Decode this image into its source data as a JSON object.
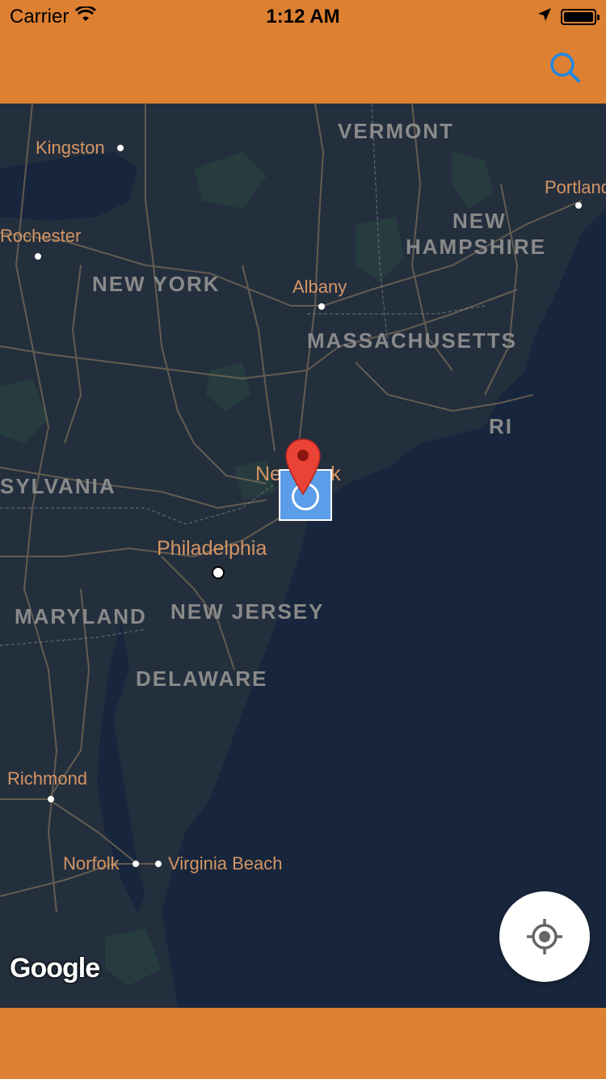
{
  "status_bar": {
    "carrier": "Carrier",
    "time": "1:12 AM",
    "battery_level": 1.0
  },
  "nav": {
    "search_icon": "search-icon"
  },
  "map": {
    "city_labels": {
      "kingston": "Kingston",
      "rochester": "Rochester",
      "portland": "Portland",
      "albany": "Albany",
      "new_york": "New York",
      "philadelphia": "Philadelphia",
      "richmond": "Richmond",
      "norfolk": "Norfolk",
      "virginia_beach": "Virginia Beach"
    },
    "state_labels": {
      "vermont": "VERMONT",
      "new_hampshire_1": "NEW",
      "new_hampshire_2": "HAMPSHIRE",
      "new_york": "NEW YORK",
      "massachusetts": "MASSACHUSETTS",
      "ri": "RI",
      "pennsylvania": "SYLVANIA",
      "maryland": "MARYLAND",
      "new_jersey": "NEW JERSEY",
      "delaware": "DELAWARE"
    },
    "attribution": "Google",
    "marker_icon": "map-pin-icon",
    "locate_icon": "crosshair-icon"
  },
  "colors": {
    "accent": "#dd8032",
    "map_land": "#242f3e",
    "map_water": "#17263c",
    "label_city": "#d59563",
    "label_state": "#8a8a8a",
    "search_icon": "#1e88e5",
    "pin": "#ea4335"
  }
}
